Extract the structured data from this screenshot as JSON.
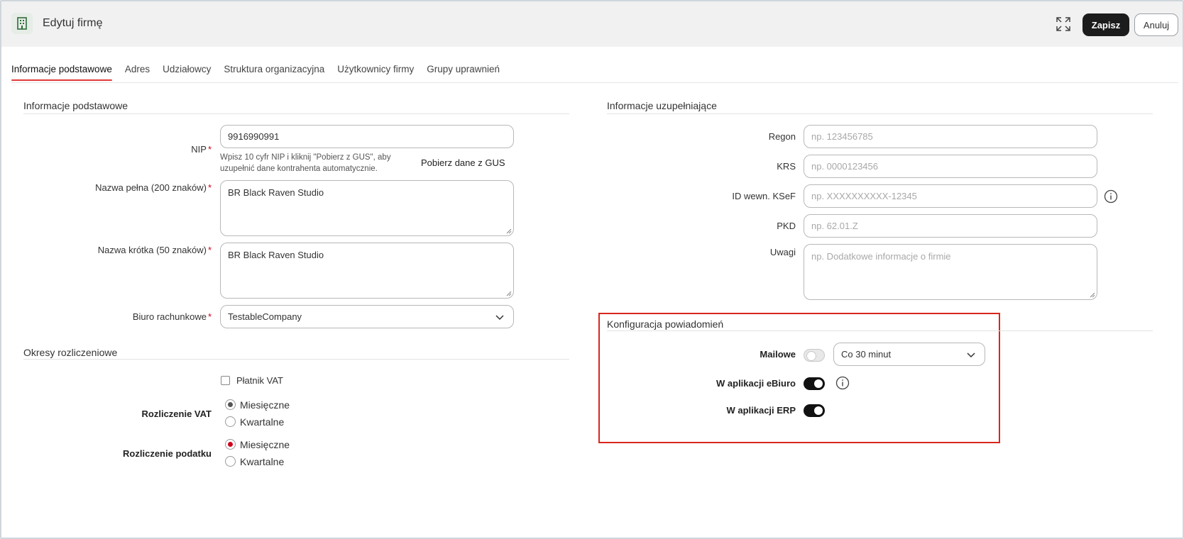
{
  "header": {
    "title": "Edytuj firmę",
    "save_label": "Zapisz",
    "cancel_label": "Anuluj",
    "icons": {
      "app": "building-icon",
      "expand": "expand-icon"
    }
  },
  "tabs": [
    {
      "label": "Informacje podstawowe",
      "active": true
    },
    {
      "label": "Adres"
    },
    {
      "label": "Udziałowcy"
    },
    {
      "label": "Struktura organizacyjna"
    },
    {
      "label": "Użytkownicy firmy"
    },
    {
      "label": "Grupy uprawnień"
    }
  ],
  "basic": {
    "section_title": "Informacje podstawowe",
    "nip": {
      "label": "NIP",
      "value": "9916990991",
      "hint": "Wpisz 10 cyfr NIP i kliknij \"Pobierz z GUS\", aby uzupełnić dane kontrahenta automatycznie.",
      "gus_link": "Pobierz dane z GUS"
    },
    "full_name": {
      "label": "Nazwa pełna (200 znaków)",
      "value": "BR Black Raven Studio"
    },
    "short_name": {
      "label": "Nazwa krótka (50 znaków)",
      "value": "BR Black Raven Studio"
    },
    "office": {
      "label": "Biuro rachunkowe",
      "value": "TestableCompany"
    },
    "required_mark": "*"
  },
  "periods": {
    "section_title": "Okresy rozliczeniowe",
    "vat_payer_label": "Płatnik VAT",
    "vat_settlement": {
      "label": "Rozliczenie VAT",
      "options": [
        "Miesięczne",
        "Kwartalne"
      ],
      "selected": "Miesięczne"
    },
    "tax_settlement": {
      "label": "Rozliczenie podatku",
      "options": [
        "Miesięczne",
        "Kwartalne"
      ],
      "selected": "Miesięczne"
    }
  },
  "extra": {
    "section_title": "Informacje uzupełniające",
    "regon": {
      "label": "Regon",
      "placeholder": "np. 123456785"
    },
    "krs": {
      "label": "KRS",
      "placeholder": "np. 0000123456"
    },
    "ksef": {
      "label": "ID wewn. KSeF",
      "placeholder": "np. XXXXXXXXXX-12345"
    },
    "pkd": {
      "label": "PKD",
      "placeholder": "np. 62.01.Z"
    },
    "notes": {
      "label": "Uwagi",
      "placeholder": "np. Dodatkowe informacje o firmie"
    }
  },
  "notifications": {
    "section_title": "Konfiguracja powiadomień",
    "email": {
      "label": "Mailowe",
      "enabled": false,
      "frequency": "Co 30 minut"
    },
    "ebiuro": {
      "label": "W aplikacji eBiuro",
      "enabled": true
    },
    "erp": {
      "label": "W aplikacji ERP",
      "enabled": true
    }
  },
  "colors": {
    "accent": "#e23a3a",
    "primary_button": "#1c1c1c",
    "highlight": "#d9261c"
  }
}
